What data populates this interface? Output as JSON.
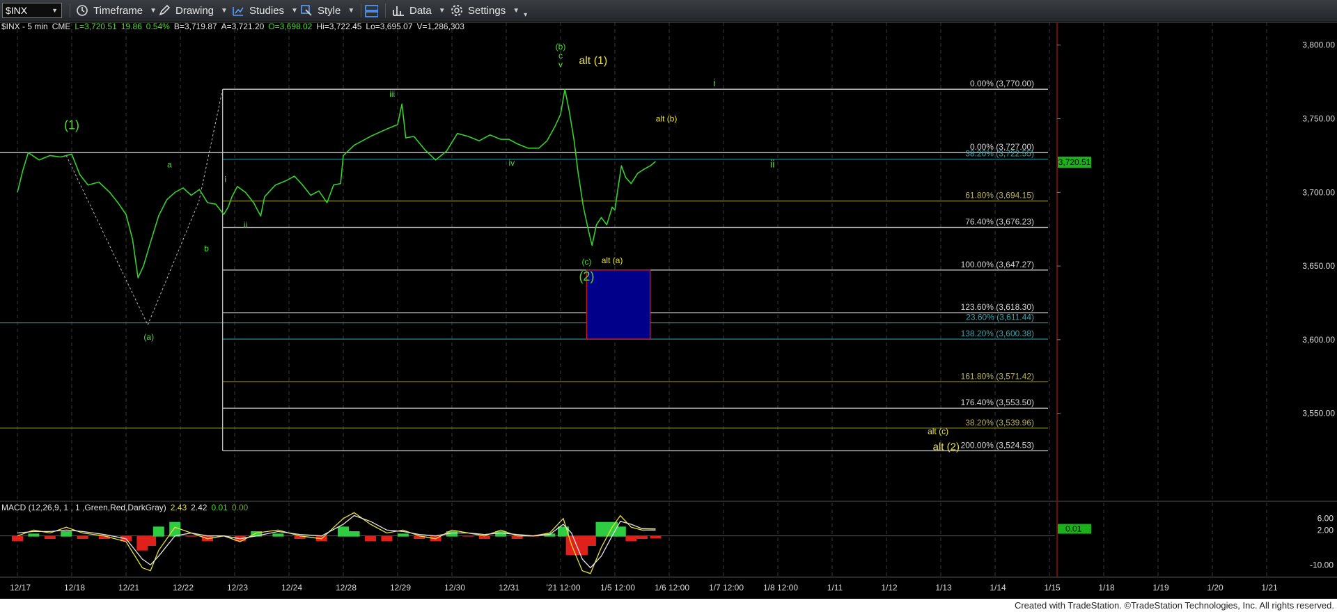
{
  "toolbar": {
    "symbol": "$INX",
    "items": [
      {
        "label": "Timeframe",
        "icon": "clock-icon"
      },
      {
        "label": "Drawing",
        "icon": "pencil-icon"
      },
      {
        "label": "Studies",
        "icon": "studies-icon"
      },
      {
        "label": "Style",
        "icon": "style-icon"
      },
      {
        "label": "",
        "icon": "layout-icon"
      },
      {
        "label": "Data",
        "icon": "data-icon"
      },
      {
        "label": "Settings",
        "icon": "gear-icon"
      }
    ]
  },
  "header": {
    "symbol": "$INX - 5 min",
    "exchange": "CME",
    "last": "L=3,720.51",
    "change": "19.86",
    "pct": "0.54%",
    "bid": "B=3,719.87",
    "ask": "A=3,721.20",
    "open": "O=3,698.02",
    "high": "Hi=3,722.45",
    "low": "Lo=3,695.07",
    "volume": "V=1,286,303"
  },
  "macd_header": {
    "label": "MACD (12,26,9, 1 , 1 ,Green,Red,DarkGray)",
    "v1": "2.43",
    "v2": "2.42",
    "v3": "0.01",
    "v4": "0.00"
  },
  "colors": {
    "price": "#36d12a",
    "wave_green": "#4ddf2f",
    "wave_yellow": "#e8e23a",
    "fib_white": "#cfcfcf",
    "fib_olive": "#7d7a2b",
    "fib_teal": "#1f7f86",
    "target_box_fill": "#00008b",
    "target_box_border": "#c21a1a",
    "last_price_tag": "#19b319"
  },
  "footer": "Created with TradeStation. ©TradeStation Technologies, Inc. All rights reserved.",
  "chart_data": {
    "type": "line",
    "title": "$INX - 5 min",
    "x_ticks": [
      "12/17",
      "12/18",
      "12/21",
      "12/22",
      "12/23",
      "12/24",
      "12/28",
      "12/29",
      "12/30",
      "12/31",
      "'21 12:00",
      "1/5 12:00",
      "1/6 12:00",
      "1/7 12:00",
      "1/8 12:00",
      "1/11",
      "1/12",
      "1/13",
      "1/14",
      "1/15",
      "1/18",
      "1/19",
      "1/20",
      "1/21"
    ],
    "price_axis": {
      "ticks": [
        "3,800.00",
        "3,750.00",
        "3,700.00",
        "3,650.00",
        "3,600.00",
        "3,550.00"
      ],
      "range": [
        3495,
        3815
      ]
    },
    "last_price": "3,720.51",
    "price_series": {
      "name": "$INX",
      "points": [
        [
          0,
          3700
        ],
        [
          0.1,
          3715
        ],
        [
          0.2,
          3727
        ],
        [
          0.4,
          3722
        ],
        [
          0.6,
          3725
        ],
        [
          0.8,
          3724
        ],
        [
          1.0,
          3726
        ],
        [
          1.15,
          3712
        ],
        [
          1.3,
          3705
        ],
        [
          1.5,
          3707
        ],
        [
          1.7,
          3700
        ],
        [
          1.85,
          3693
        ],
        [
          2.0,
          3685
        ],
        [
          2.12,
          3668
        ],
        [
          2.22,
          3642
        ],
        [
          2.32,
          3650
        ],
        [
          2.45,
          3666
        ],
        [
          2.6,
          3684
        ],
        [
          2.75,
          3695
        ],
        [
          2.9,
          3700
        ],
        [
          3.05,
          3703
        ],
        [
          3.2,
          3698
        ],
        [
          3.35,
          3702
        ],
        [
          3.5,
          3693
        ],
        [
          3.65,
          3692
        ],
        [
          3.8,
          3685
        ],
        [
          3.88,
          3690
        ],
        [
          3.95,
          3697
        ],
        [
          4.05,
          3704
        ],
        [
          4.2,
          3700
        ],
        [
          4.35,
          3693
        ],
        [
          4.42,
          3688
        ],
        [
          4.48,
          3684
        ],
        [
          4.55,
          3697
        ],
        [
          4.75,
          3705
        ],
        [
          4.95,
          3708
        ],
        [
          5.1,
          3711
        ],
        [
          5.25,
          3705
        ],
        [
          5.4,
          3698
        ],
        [
          5.55,
          3701
        ],
        [
          5.7,
          3693
        ],
        [
          5.82,
          3705
        ],
        [
          5.95,
          3706
        ],
        [
          6.0,
          3725
        ],
        [
          6.2,
          3732
        ],
        [
          6.5,
          3738
        ],
        [
          6.8,
          3743
        ],
        [
          7.0,
          3746
        ],
        [
          7.08,
          3760
        ],
        [
          7.15,
          3737
        ],
        [
          7.3,
          3738
        ],
        [
          7.5,
          3729
        ],
        [
          7.7,
          3722
        ],
        [
          7.9,
          3728
        ],
        [
          8.1,
          3740
        ],
        [
          8.3,
          3738
        ],
        [
          8.5,
          3735
        ],
        [
          8.7,
          3739
        ],
        [
          8.9,
          3736
        ],
        [
          9.05,
          3736
        ],
        [
          9.2,
          3733
        ],
        [
          9.4,
          3730
        ],
        [
          9.6,
          3730
        ],
        [
          9.75,
          3735
        ],
        [
          9.9,
          3745
        ],
        [
          10.0,
          3753
        ],
        [
          10.08,
          3770
        ],
        [
          10.16,
          3755
        ],
        [
          10.25,
          3735
        ],
        [
          10.32,
          3714
        ],
        [
          10.42,
          3690
        ],
        [
          10.52,
          3673
        ],
        [
          10.58,
          3664
        ],
        [
          10.66,
          3678
        ],
        [
          10.75,
          3683
        ],
        [
          10.85,
          3678
        ],
        [
          10.95,
          3690
        ],
        [
          11.0,
          3688
        ],
        [
          11.05,
          3701
        ],
        [
          11.12,
          3718
        ],
        [
          11.2,
          3710
        ],
        [
          11.3,
          3706
        ],
        [
          11.42,
          3713
        ],
        [
          11.55,
          3716
        ],
        [
          11.65,
          3718
        ],
        [
          11.75,
          3721
        ]
      ]
    },
    "fib_levels": [
      {
        "label": "0.00% (3,770.00)",
        "value": 3770,
        "color": "#cfcfcf",
        "x0": 4.0
      },
      {
        "label": "0.00% (3,727.00)",
        "value": 3727,
        "color": "#cfcfcf",
        "x0": 0
      },
      {
        "label": "38.20% (3,722.55)",
        "value": 3722.55,
        "color": "#1f7f86",
        "x0": 4.0
      },
      {
        "label": "61.80% (3,694.15)",
        "value": 3694.15,
        "color": "#7d7a2b",
        "x0": 4.0
      },
      {
        "label": "76.40% (3,676.23)",
        "value": 3676.23,
        "color": "#cfcfcf",
        "x0": 4.0
      },
      {
        "label": "100.00% (3,647.27)",
        "value": 3647.27,
        "color": "#cfcfcf",
        "x0": 4.0
      },
      {
        "label": "123.60% (3,618.30)",
        "value": 3618.3,
        "color": "#cfcfcf",
        "x0": 4.0
      },
      {
        "label": "23.60% (3,611.44)",
        "value": 3611.44,
        "color": "#1f7f86",
        "x0": 0
      },
      {
        "label": "138.20% (3,600.38)",
        "value": 3600.38,
        "color": "#1f7f86",
        "x0": 4.0
      },
      {
        "label": "161.80% (3,571.42)",
        "value": 3571.42,
        "color": "#7d7a2b",
        "x0": 4.0
      },
      {
        "label": "176.40% (3,553.50)",
        "value": 3553.5,
        "color": "#cfcfcf",
        "x0": 4.0
      },
      {
        "label": "38.20% (3,539.96)",
        "value": 3539.96,
        "color": "#7d7a2b",
        "x0": 0
      },
      {
        "label": "200.00% (3,524.53)",
        "value": 3524.53,
        "color": "#cfcfcf",
        "x0": 4.0
      }
    ],
    "target_box": {
      "x": [
        10.48,
        11.65
      ],
      "y": [
        3600.38,
        3647.27
      ]
    },
    "wave_labels": [
      {
        "text": "(1)",
        "x": 1.0,
        "price": 3743,
        "color": "#4ddf2f",
        "size": 18
      },
      {
        "text": "a",
        "x": 2.8,
        "price": 3717,
        "color": "#4ddf2f",
        "size": 12
      },
      {
        "text": "b",
        "x": 3.48,
        "price": 3660,
        "color": "#4ddf2f",
        "size": 12
      },
      {
        "text": "i",
        "x": 3.83,
        "price": 3707,
        "color": "#4ddf2f",
        "size": 12
      },
      {
        "text": "ii",
        "x": 4.2,
        "price": 3676,
        "color": "#4ddf2f",
        "size": 12
      },
      {
        "text": "(a)",
        "x": 2.42,
        "price": 3600,
        "color": "#4ddf2f",
        "size": 12
      },
      {
        "text": "iii",
        "x": 6.9,
        "price": 3765,
        "color": "#4ddf2f",
        "size": 12
      },
      {
        "text": "iv",
        "x": 9.1,
        "price": 3718,
        "color": "#4ddf2f",
        "size": 12
      },
      {
        "text": "(b)",
        "x": 10.0,
        "price": 3797,
        "color": "#4ddf2f",
        "size": 12
      },
      {
        "text": "c",
        "x": 10.0,
        "price": 3791,
        "color": "#4ddf2f",
        "size": 12
      },
      {
        "text": "v",
        "x": 10.0,
        "price": 3785,
        "color": "#4ddf2f",
        "size": 12
      },
      {
        "text": "alt (1)",
        "x": 10.6,
        "price": 3787,
        "color": "#e8e23a",
        "size": 16
      },
      {
        "text": "i",
        "x": 12.83,
        "price": 3772,
        "color": "#4ddf2f",
        "size": 15
      },
      {
        "text": "alt (b)",
        "x": 11.95,
        "price": 3748,
        "color": "#e8e23a",
        "size": 12
      },
      {
        "text": "ii",
        "x": 13.9,
        "price": 3717,
        "color": "#4ddf2f",
        "size": 15
      },
      {
        "text": "(c)",
        "x": 10.48,
        "price": 3651,
        "color": "#4ddf2f",
        "size": 12
      },
      {
        "text": "alt (a)",
        "x": 10.95,
        "price": 3652,
        "color": "#e8e23a",
        "size": 12
      },
      {
        "text": "(2)",
        "x": 10.48,
        "price": 3640,
        "color": "#4ddf2f",
        "size": 18
      },
      {
        "text": "alt (c)",
        "x": 16.95,
        "price": 3536,
        "color": "#e8e23a",
        "size": 12
      },
      {
        "text": "alt (2)",
        "x": 17.1,
        "price": 3525,
        "color": "#e8e23a",
        "size": 15
      }
    ],
    "macd": {
      "ticks": [
        "6.00",
        "2.00",
        "-10.00"
      ],
      "range": [
        -14,
        10
      ],
      "last_value": "0.01",
      "macd_line": [
        [
          0,
          0
        ],
        [
          0.3,
          2
        ],
        [
          0.6,
          1
        ],
        [
          0.9,
          3
        ],
        [
          1.2,
          1
        ],
        [
          1.6,
          0
        ],
        [
          2.0,
          -2
        ],
        [
          2.3,
          -11
        ],
        [
          2.45,
          -12
        ],
        [
          2.6,
          -5
        ],
        [
          2.9,
          3
        ],
        [
          3.2,
          1
        ],
        [
          3.5,
          -1
        ],
        [
          3.8,
          0
        ],
        [
          4.1,
          -2
        ],
        [
          4.4,
          1
        ],
        [
          4.8,
          2
        ],
        [
          5.2,
          0
        ],
        [
          5.6,
          -1
        ],
        [
          6.0,
          6
        ],
        [
          6.2,
          8
        ],
        [
          6.5,
          4
        ],
        [
          6.8,
          1
        ],
        [
          7.1,
          2
        ],
        [
          7.4,
          0
        ],
        [
          7.7,
          -1
        ],
        [
          8.0,
          2
        ],
        [
          8.3,
          1
        ],
        [
          8.6,
          0
        ],
        [
          8.9,
          2
        ],
        [
          9.2,
          0
        ],
        [
          9.5,
          0
        ],
        [
          9.8,
          1
        ],
        [
          10.05,
          6
        ],
        [
          10.2,
          -3
        ],
        [
          10.4,
          -12
        ],
        [
          10.55,
          -13
        ],
        [
          10.75,
          -4
        ],
        [
          10.95,
          3
        ],
        [
          11.1,
          7
        ],
        [
          11.3,
          3
        ],
        [
          11.5,
          2
        ],
        [
          11.75,
          2
        ]
      ],
      "signal_line": [
        [
          0,
          1
        ],
        [
          0.3,
          1.5
        ],
        [
          0.6,
          1.5
        ],
        [
          0.9,
          2
        ],
        [
          1.2,
          1.5
        ],
        [
          1.6,
          0.5
        ],
        [
          2.0,
          -1
        ],
        [
          2.3,
          -8
        ],
        [
          2.45,
          -10
        ],
        [
          2.6,
          -7
        ],
        [
          2.9,
          0
        ],
        [
          3.2,
          1
        ],
        [
          3.5,
          0
        ],
        [
          3.8,
          0
        ],
        [
          4.1,
          -1
        ],
        [
          4.4,
          0
        ],
        [
          4.8,
          1.5
        ],
        [
          5.2,
          0.5
        ],
        [
          5.6,
          0
        ],
        [
          6.0,
          4
        ],
        [
          6.2,
          7
        ],
        [
          6.5,
          5
        ],
        [
          6.8,
          2
        ],
        [
          7.1,
          1.5
        ],
        [
          7.4,
          0.5
        ],
        [
          7.7,
          0
        ],
        [
          8.0,
          1
        ],
        [
          8.3,
          1
        ],
        [
          8.6,
          0.5
        ],
        [
          8.9,
          1
        ],
        [
          9.2,
          0.5
        ],
        [
          9.5,
          0
        ],
        [
          9.8,
          0.5
        ],
        [
          10.05,
          4
        ],
        [
          10.2,
          1
        ],
        [
          10.4,
          -8
        ],
        [
          10.55,
          -11
        ],
        [
          10.75,
          -7
        ],
        [
          10.95,
          0
        ],
        [
          11.1,
          5
        ],
        [
          11.3,
          4
        ],
        [
          11.5,
          2.5
        ],
        [
          11.75,
          2.4
        ]
      ]
    }
  }
}
